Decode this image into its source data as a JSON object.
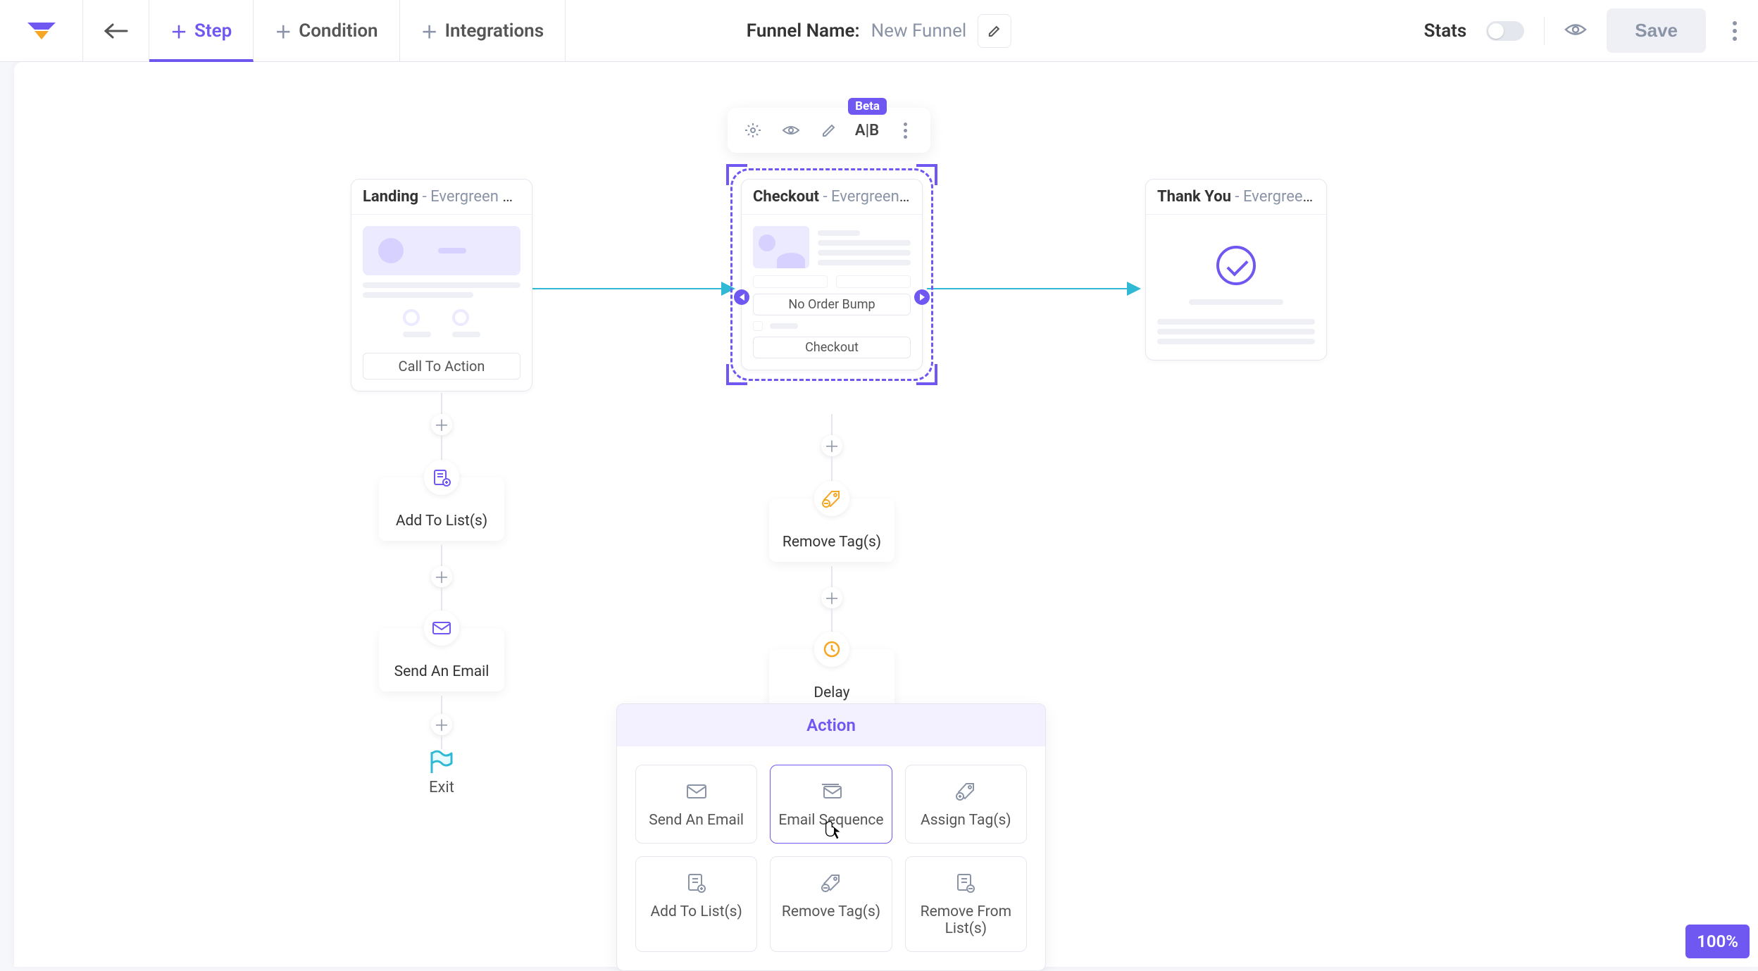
{
  "topbar": {
    "tabs": {
      "step": "Step",
      "condition": "Condition",
      "integrations": "Integrations"
    },
    "funnel_label": "Funnel Name:",
    "funnel_value": "New Funnel",
    "stats": "Stats",
    "save": "Save",
    "ab": "A|B",
    "beta": "Beta"
  },
  "steps": {
    "landing": {
      "title": "Landing",
      "subtitle": " - Evergreen Lan...",
      "cta": "Call To Action"
    },
    "checkout": {
      "title": "Checkout",
      "subtitle": " - Evergreen Che...",
      "no_bump": "No Order Bump",
      "checkout": "Checkout"
    },
    "thankyou": {
      "title": "Thank You",
      "subtitle": " - Evergreen Tha..."
    }
  },
  "nodes": {
    "add_to_lists": "Add To List(s)",
    "send_email": "Send An Email",
    "remove_tags": "Remove Tag(s)",
    "delay": "Delay",
    "exit": "Exit"
  },
  "panel": {
    "header": "Action",
    "opts": {
      "send_email": "Send An Email",
      "email_seq": "Email Sequence",
      "assign_tags": "Assign Tag(s)",
      "add_to_lists": "Add To List(s)",
      "remove_tags": "Remove Tag(s)",
      "remove_from_lists": "Remove From List(s)"
    }
  },
  "zoom": "100%"
}
